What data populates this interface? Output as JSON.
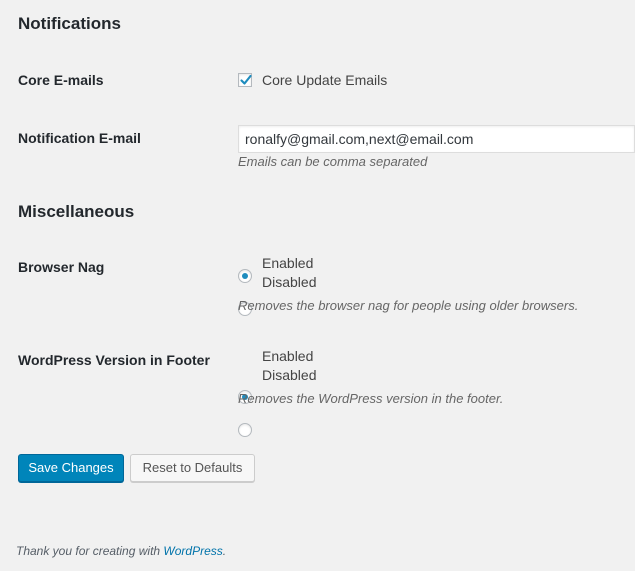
{
  "notifications": {
    "title": "Notifications",
    "core_emails": {
      "label": "Core E-mails",
      "option_label": "Core Update Emails",
      "checked": true
    },
    "notification_email": {
      "label": "Notification E-mail",
      "value": "ronalfy@gmail.com,next@email.com",
      "description": "Emails can be comma separated"
    }
  },
  "miscellaneous": {
    "title": "Miscellaneous",
    "browser_nag": {
      "label": "Browser Nag",
      "options": [
        "Enabled",
        "Disabled"
      ],
      "selected": "Enabled",
      "description": "Removes the browser nag for people using older browsers."
    },
    "version_footer": {
      "label": "WordPress Version in Footer",
      "options": [
        "Enabled",
        "Disabled"
      ],
      "selected": "Enabled",
      "description": "Removes the WordPress version in the footer."
    }
  },
  "actions": {
    "save_label": "Save Changes",
    "reset_label": "Reset to Defaults"
  },
  "footer": {
    "text": "Thank you for creating with ",
    "link_text": "WordPress",
    "suffix": "."
  },
  "colors": {
    "background": "#f1f1f1",
    "primary_button": "#0085ba",
    "link": "#0073aa",
    "checked_accent": "#1e8cbe"
  }
}
